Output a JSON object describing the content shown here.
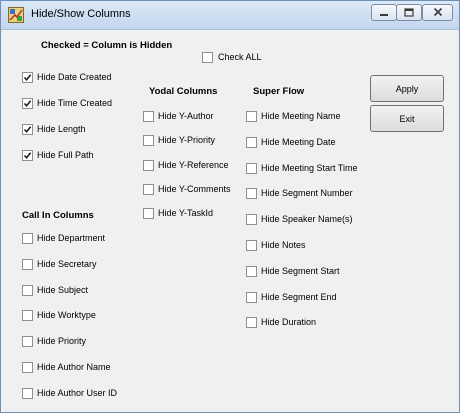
{
  "window": {
    "title": "Hide/Show Columns"
  },
  "header": {
    "note": "Checked = Column is Hidden",
    "check_all_label": "Check ALL"
  },
  "main_items": [
    {
      "label": "Hide Date Created",
      "checked": true
    },
    {
      "label": "Hide Time Created",
      "checked": true
    },
    {
      "label": "Hide Length",
      "checked": true
    },
    {
      "label": "Hide Full Path",
      "checked": true
    }
  ],
  "call_in": {
    "title": "Call In Columns",
    "items": [
      {
        "label": "Hide Department",
        "checked": false
      },
      {
        "label": "Hide Secretary",
        "checked": false
      },
      {
        "label": "Hide Subject",
        "checked": false
      },
      {
        "label": "Hide Worktype",
        "checked": false
      },
      {
        "label": "Hide Priority",
        "checked": false
      },
      {
        "label": "Hide Author Name",
        "checked": false
      },
      {
        "label": "Hide Author User ID",
        "checked": false
      }
    ]
  },
  "yodal": {
    "title": "Yodal Columns",
    "items": [
      {
        "label": "Hide Y-Author",
        "checked": false
      },
      {
        "label": "Hide Y-Priority",
        "checked": false
      },
      {
        "label": "Hide Y-Reference",
        "checked": false
      },
      {
        "label": "Hide Y-Comments",
        "checked": false
      },
      {
        "label": "Hide Y-TaskId",
        "checked": false
      }
    ]
  },
  "super_flow": {
    "title": "Super Flow",
    "items": [
      {
        "label": "Hide Meeting Name",
        "checked": false
      },
      {
        "label": "Hide Meeting Date",
        "checked": false
      },
      {
        "label": "Hide Meeting Start Time",
        "checked": false
      },
      {
        "label": "Hide Segment Number",
        "checked": false
      },
      {
        "label": "Hide Speaker Name(s)",
        "checked": false
      },
      {
        "label": "Hide Notes",
        "checked": false
      },
      {
        "label": "Hide Segment Start",
        "checked": false
      },
      {
        "label": "Hide Segment End",
        "checked": false
      },
      {
        "label": "Hide Duration",
        "checked": false
      }
    ]
  },
  "buttons": {
    "apply": "Apply",
    "exit": "Exit"
  },
  "colors": {
    "title_bar": "#c3d6ee",
    "client": "#f0f0f0",
    "check_mark": "#1f1f1f"
  }
}
